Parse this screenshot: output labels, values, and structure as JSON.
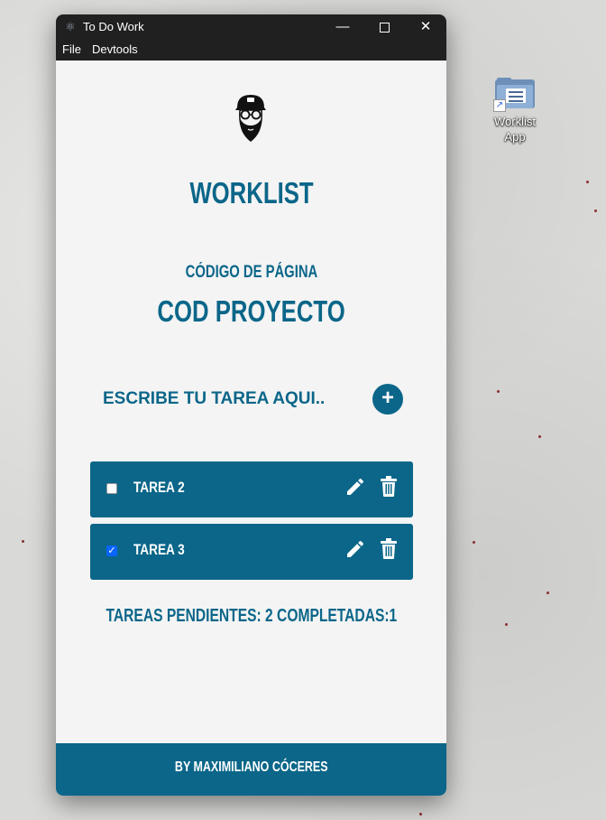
{
  "desktop": {
    "shortcut_label": "Worklist App",
    "icon": "folder-shortcut-icon"
  },
  "window": {
    "title": "To Do Work",
    "icon": "electron-app-icon",
    "controls": {
      "minimize": "—",
      "close": "✕"
    }
  },
  "menu": {
    "items": [
      "File",
      "Devtools"
    ]
  },
  "app": {
    "logo": "bearded-man-avatar",
    "title": "WORKLIST",
    "page_code_label": "CÓDIGO DE PÁGINA",
    "project_code": "COD PROYECTO",
    "input_placeholder": "ESCRIBE TU TAREA AQUI..",
    "add_label": "+",
    "tasks": [
      {
        "name": "TAREA 2",
        "done": false
      },
      {
        "name": "TAREA 3",
        "done": true
      }
    ],
    "summary": "TAREAS PENDIENTES: 2 COMPLETADAS:1",
    "footer": "BY MAXIMILIANO CÓCERES"
  },
  "colors": {
    "accent": "#0b6689",
    "background": "#f4f4f4",
    "titlebar": "#202020"
  }
}
